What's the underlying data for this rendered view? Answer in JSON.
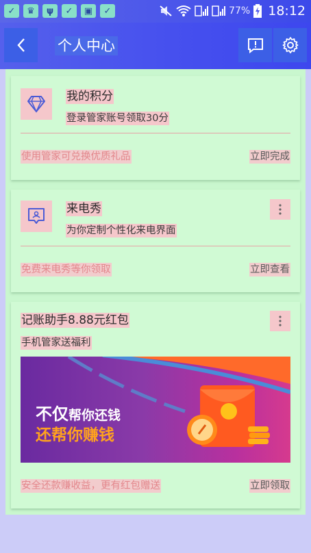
{
  "status_bar": {
    "battery": "77%",
    "time": "18:12"
  },
  "header": {
    "title": "个人中心",
    "back_icon": "chevron-left-icon",
    "feedback_icon": "feedback-icon",
    "settings_icon": "gear-icon"
  },
  "cards": [
    {
      "icon": "diamond-icon",
      "title": "我的积分",
      "subtitle": "登录管家账号领取30分",
      "footer_text": "使用管家可兑换优质礼品",
      "action": "立即完成"
    },
    {
      "icon": "caller-show-icon",
      "title": "来电秀",
      "subtitle": "为你定制个性化来电界面",
      "footer_text": "免费来电秀等你领取",
      "action": "立即查看"
    },
    {
      "title": "记账助手8.88元红包",
      "subtitle": "手机管家送福利",
      "banner": {
        "line1_big": "不仅",
        "line1_small": "帮你还钱",
        "line2": "还帮你赚钱"
      },
      "footer_text": "安全还款赚收益，更有红包赠送",
      "action": "立即领取"
    }
  ],
  "colors": {
    "header_blue": "#4650ee",
    "panel_green": "#c9f7ce",
    "card_green": "#d0fad4",
    "highlight_pink": "#f5c7cb",
    "background_lavender": "#ccccf8"
  }
}
